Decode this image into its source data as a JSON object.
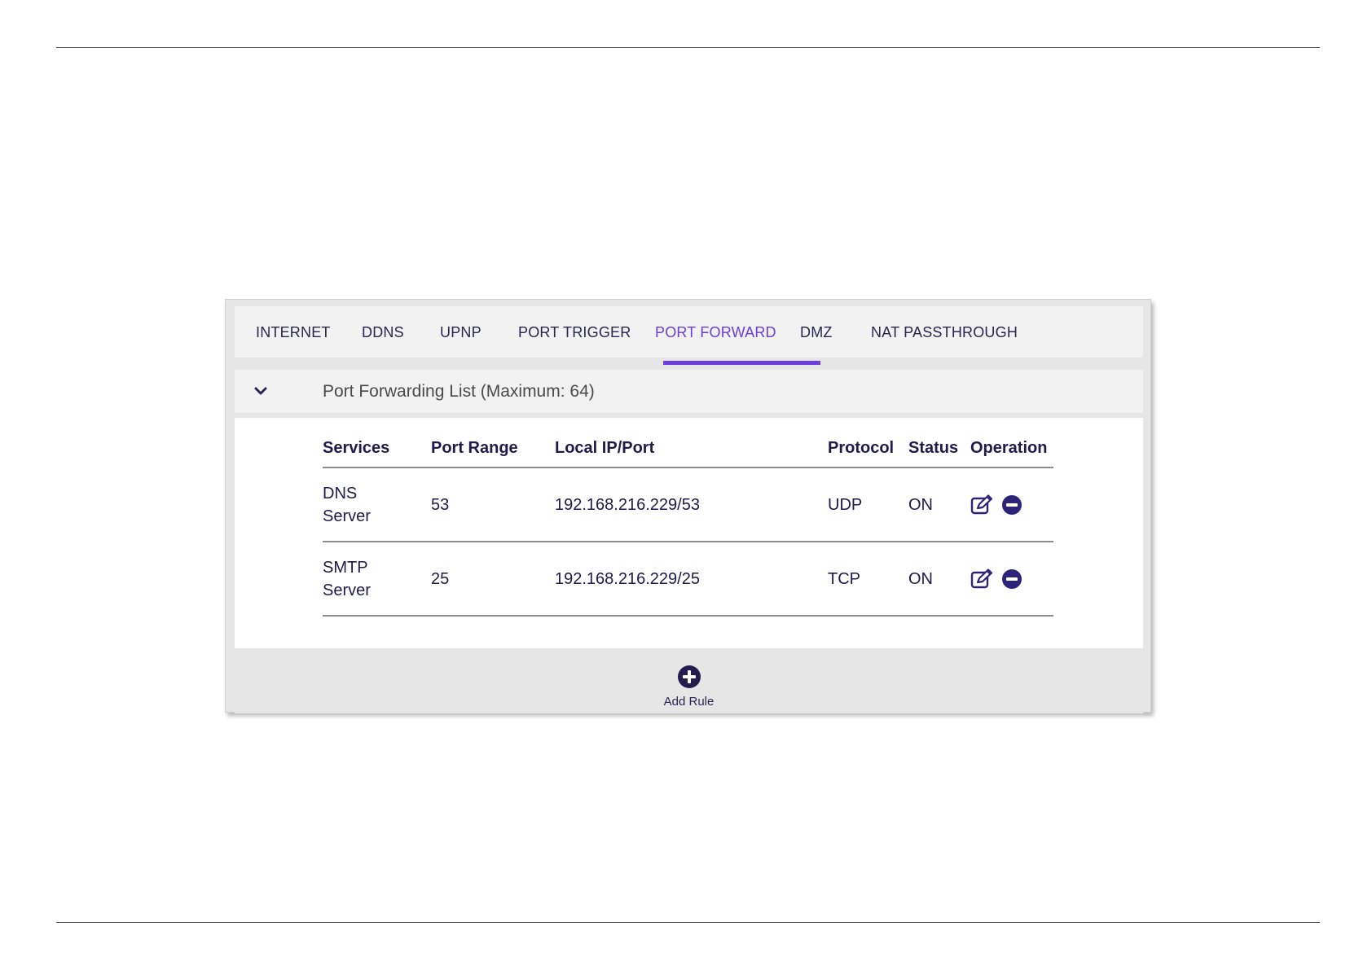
{
  "tabs": [
    {
      "label": "INTERNET",
      "active": false
    },
    {
      "label": "DDNS",
      "active": false
    },
    {
      "label": "UPNP",
      "active": false
    },
    {
      "label": "PORT TRIGGER",
      "active": false
    },
    {
      "label": "PORT FORWARD",
      "active": true
    },
    {
      "label": "DMZ",
      "active": false
    },
    {
      "label": "NAT PASSTHROUGH",
      "active": false
    }
  ],
  "section": {
    "title": "Port Forwarding List (Maximum: 64)",
    "icon": "chevron-down-icon"
  },
  "table": {
    "headers": {
      "services": "Services",
      "port_range": "Port Range",
      "local_ip_port": "Local IP/Port",
      "protocol": "Protocol",
      "status": "Status",
      "operation": "Operation"
    },
    "rows": [
      {
        "service": "DNS Server",
        "port_range": "53",
        "local_ip_port": "192.168.216.229/53",
        "protocol": "UDP",
        "status": "ON"
      },
      {
        "service": "SMTP Server",
        "port_range": "25",
        "local_ip_port": "192.168.216.229/25",
        "protocol": "TCP",
        "status": "ON"
      }
    ],
    "operation_icons": [
      "edit-icon",
      "remove-icon"
    ]
  },
  "footer": {
    "add_rule_label": "Add Rule",
    "add_rule_icon": "plus-circle-icon"
  },
  "colors": {
    "accent": "#6c3ee0",
    "text_dark": "#1f1a4d",
    "panel_bg": "#e6e6e6",
    "header_bg": "#f2f2f2"
  }
}
